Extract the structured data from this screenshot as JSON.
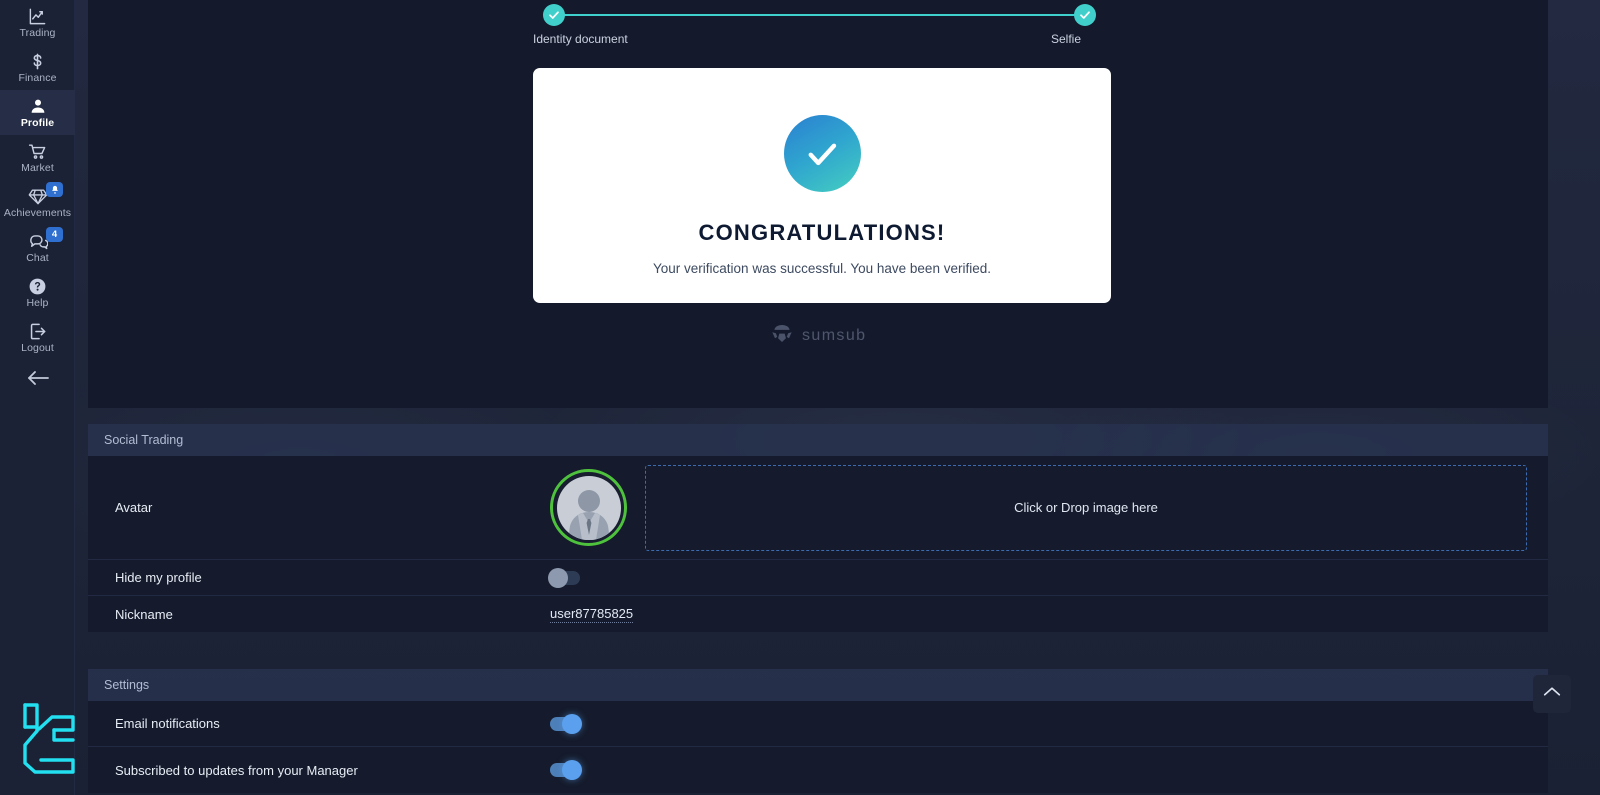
{
  "colors": {
    "accent_teal": "#41cfcb",
    "accent_blue": "#2f6fd0",
    "avatar_ring_green": "#4ec23c",
    "panel_dark": "#141a2c",
    "sidebar_bg": "#1c2236",
    "logo_cyan": "#22e0f0",
    "toggle_on": "#5aa0ee"
  },
  "sidebar": {
    "items": [
      {
        "label": "Trading",
        "icon": "chart-line-icon",
        "active": false,
        "badge": null
      },
      {
        "label": "Finance",
        "icon": "dollar-icon",
        "active": false,
        "badge": null
      },
      {
        "label": "Profile",
        "icon": "user-icon",
        "active": true,
        "badge": null
      },
      {
        "label": "Market",
        "icon": "cart-icon",
        "active": false,
        "badge": null
      },
      {
        "label": "Achievements",
        "icon": "diamond-icon",
        "active": false,
        "badge": "bell"
      },
      {
        "label": "Chat",
        "icon": "chat-icon",
        "active": false,
        "badge": "4"
      },
      {
        "label": "Help",
        "icon": "question-icon",
        "active": false,
        "badge": null
      },
      {
        "label": "Logout",
        "icon": "logout-icon",
        "active": false,
        "badge": null
      }
    ],
    "collapse_icon": "arrow-left-icon",
    "brand_logo": "brand-mark-icon"
  },
  "kyc": {
    "steps": [
      {
        "label": "Identity document",
        "state": "complete"
      },
      {
        "label": "Selfie",
        "state": "complete"
      }
    ],
    "result": {
      "icon": "check-circle-icon",
      "title": "CONGRATULATIONS!",
      "subtitle": "Your verification was successful. You have been verified."
    },
    "provider": {
      "name": "sumsub",
      "logo": "sumsub-logo-icon"
    }
  },
  "social_trading": {
    "title": "Social Trading",
    "avatar": {
      "label": "Avatar",
      "dropzone_text": "Click or Drop image here"
    },
    "hide_profile": {
      "label": "Hide my profile",
      "enabled": false
    },
    "nickname": {
      "label": "Nickname",
      "value": "user87785825"
    }
  },
  "settings": {
    "title": "Settings",
    "rows": [
      {
        "label": "Email notifications",
        "enabled": true
      },
      {
        "label": "Subscribed to updates from your Manager",
        "enabled": true
      }
    ]
  },
  "scroll_top": {
    "icon": "chevron-up-icon"
  }
}
